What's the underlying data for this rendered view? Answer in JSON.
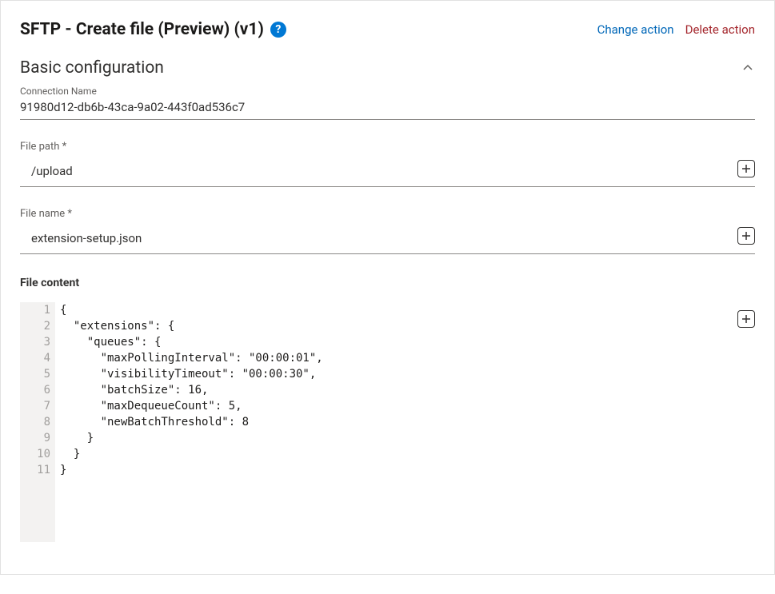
{
  "header": {
    "title": "SFTP - Create file (Preview) (v1)",
    "help_tooltip": "?",
    "change_action": "Change action",
    "delete_action": "Delete action"
  },
  "section": {
    "title": "Basic configuration"
  },
  "connection": {
    "label": "Connection Name",
    "value": "91980d12-db6b-43ca-9a02-443f0ad536c7"
  },
  "file_path": {
    "label": "File path *",
    "value": "/upload"
  },
  "file_name": {
    "label": "File name *",
    "value": "extension-setup.json"
  },
  "file_content": {
    "label": "File content",
    "lines": [
      "{",
      "  \"extensions\": {",
      "    \"queues\": {",
      "      \"maxPollingInterval\": \"00:00:01\",",
      "      \"visibilityTimeout\": \"00:00:30\",",
      "      \"batchSize\": 16,",
      "      \"maxDequeueCount\": 5,",
      "      \"newBatchThreshold\": 8",
      "    }",
      "  }",
      "}"
    ]
  }
}
